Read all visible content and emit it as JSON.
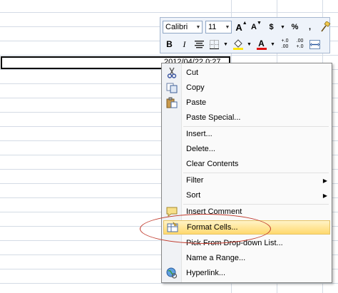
{
  "cell": {
    "value": "2012/04/22 0:27"
  },
  "mini_toolbar": {
    "font_name": "Calibri",
    "font_size": "11",
    "grow_font": "A",
    "shrink_font": "A",
    "currency": "$",
    "percent": "%",
    "bold": "B",
    "italic": "I",
    "font_color_letter": "A",
    "inc_decimal": "+.0\n.00",
    "dec_decimal": ".00\n+.0"
  },
  "context_menu": {
    "items": [
      {
        "label": "Cut",
        "icon": "scissors-icon"
      },
      {
        "label": "Copy",
        "icon": "copy-icon"
      },
      {
        "label": "Paste",
        "icon": "paste-icon"
      },
      {
        "label": "Paste Special..."
      },
      {
        "label": "Insert..."
      },
      {
        "label": "Delete..."
      },
      {
        "label": "Clear Contents"
      },
      {
        "label": "Filter",
        "submenu": true
      },
      {
        "label": "Sort",
        "submenu": true
      },
      {
        "label": "Insert Comment",
        "icon": "comment-icon"
      },
      {
        "label": "Format Cells...",
        "icon": "format-cells-icon",
        "highlighted": true
      },
      {
        "label": "Pick From Drop-down List..."
      },
      {
        "label": "Name a Range..."
      },
      {
        "label": "Hyperlink...",
        "icon": "globe-icon"
      }
    ]
  },
  "colors": {
    "highlight": "#ffd96e",
    "annotation": "#c0392b",
    "font_color_bar": "#e01010",
    "fill_color_bar": "#ffe600"
  }
}
